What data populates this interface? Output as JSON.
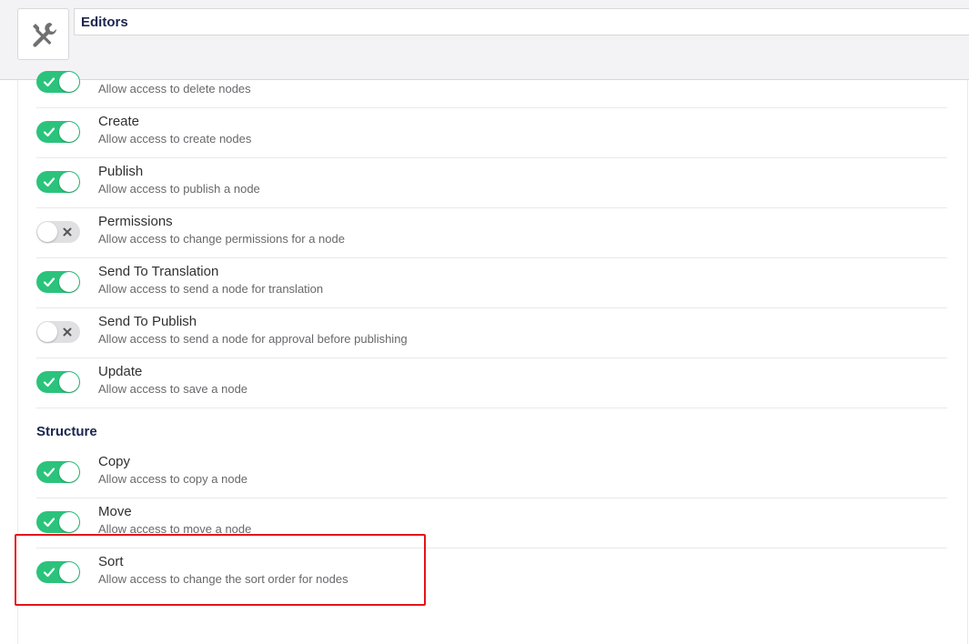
{
  "header": {
    "name_value": "Editors",
    "icon": "tools-icon"
  },
  "rows_top": [
    {
      "title": "",
      "description": "Allow access to delete nodes",
      "enabled": true
    },
    {
      "title": "Create",
      "description": "Allow access to create nodes",
      "enabled": true
    },
    {
      "title": "Publish",
      "description": "Allow access to publish a node",
      "enabled": true
    },
    {
      "title": "Permissions",
      "description": "Allow access to change permissions for a node",
      "enabled": false
    },
    {
      "title": "Send To Translation",
      "description": "Allow access to send a node for translation",
      "enabled": true
    },
    {
      "title": "Send To Publish",
      "description": "Allow access to send a node for approval before publishing",
      "enabled": false
    },
    {
      "title": "Update",
      "description": "Allow access to save a node",
      "enabled": true
    }
  ],
  "structure": {
    "heading": "Structure",
    "rows": [
      {
        "title": "Copy",
        "description": "Allow access to copy a node",
        "enabled": true
      },
      {
        "title": "Move",
        "description": "Allow access to move a node",
        "enabled": true
      },
      {
        "title": "Sort",
        "description": "Allow access to change the sort order for nodes",
        "enabled": true
      }
    ]
  },
  "colors": {
    "toggle_on": "#2bc37c",
    "toggle_off": "#e0e0e3",
    "highlight": "#e3151a"
  }
}
